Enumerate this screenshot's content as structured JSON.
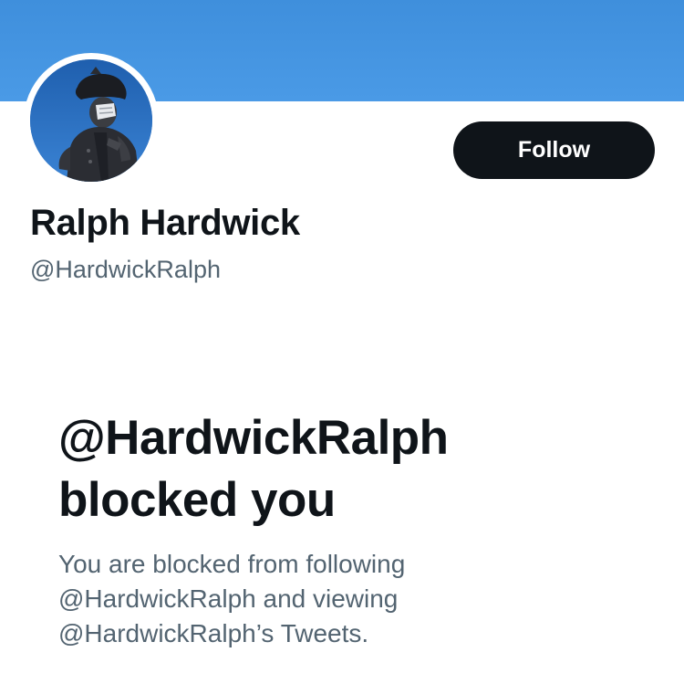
{
  "profile": {
    "display_name": "Ralph Hardwick",
    "handle": "@HardwickRalph",
    "avatar_icon": "statue-avatar",
    "banner_color": "#4495e2"
  },
  "actions": {
    "follow_label": "Follow"
  },
  "blocked": {
    "title_line1": "@HardwickRalph",
    "title_line2": "blocked you",
    "desc_line1": "You are blocked from following",
    "desc_line2": "@HardwickRalph and viewing",
    "desc_line3": "@HardwickRalph’s Tweets."
  },
  "colors": {
    "text_primary": "#0f1419",
    "text_secondary": "#536471",
    "button_bg": "#0f1419"
  }
}
